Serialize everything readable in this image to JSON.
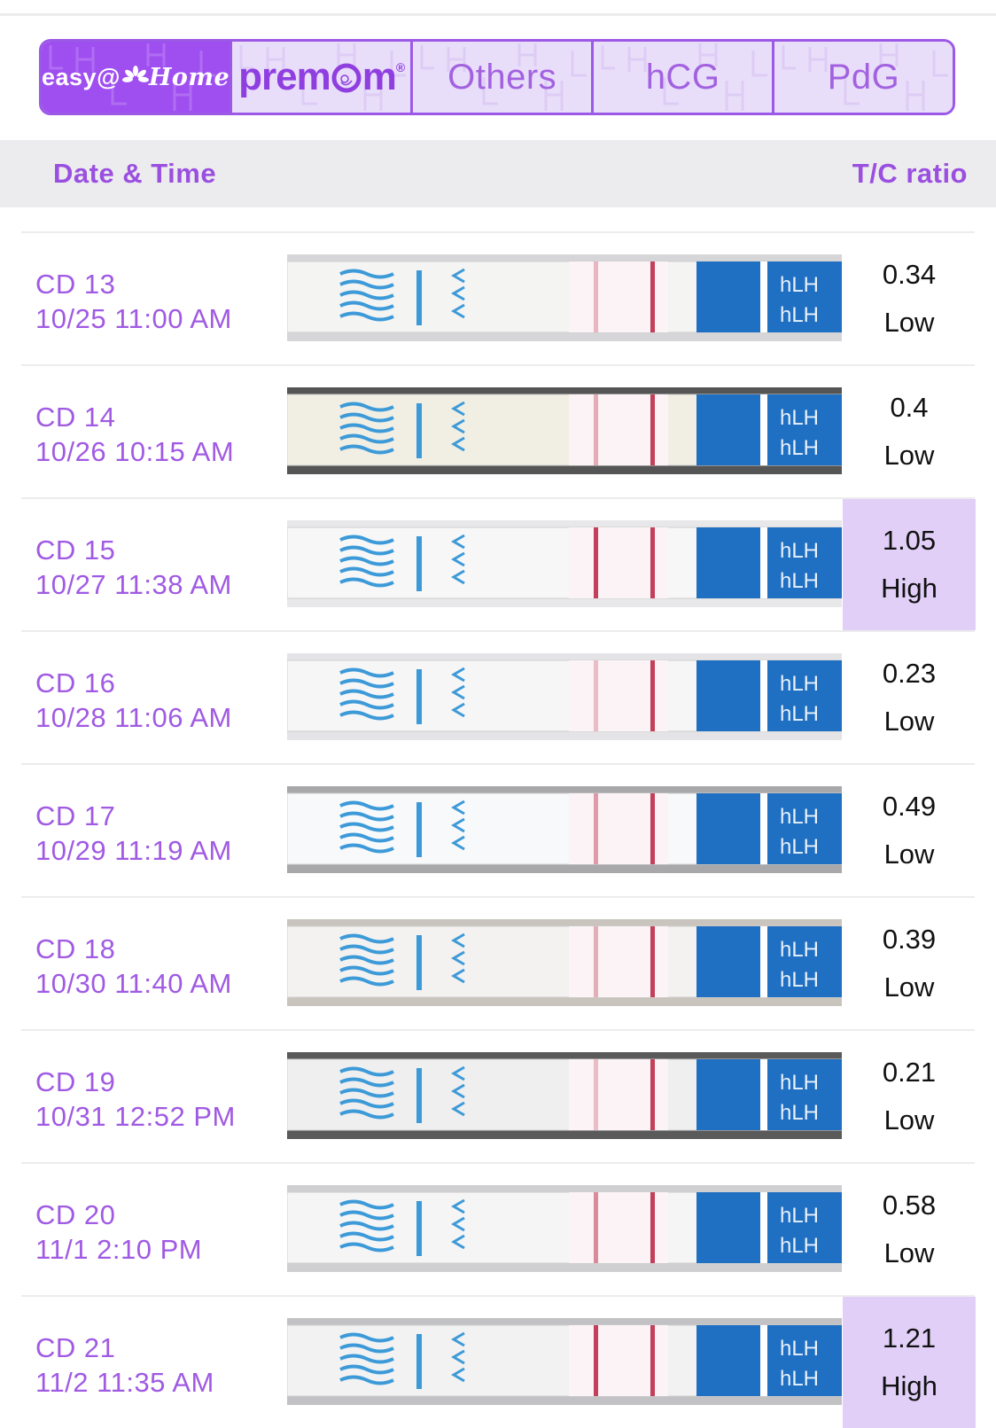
{
  "tabs": {
    "easy_home": {
      "part1": "easy@",
      "part2": "Home"
    },
    "premom": {
      "prefix": "prem",
      "suffix": "m",
      "mark": "®"
    },
    "others": "Others",
    "hcg": "hCG",
    "pdg": "PdG"
  },
  "header": {
    "date_time": "Date & Time",
    "tc_ratio": "T/C ratio"
  },
  "strip_label": "hLH",
  "colors": {
    "accent": "#9f4ef0",
    "high_highlight": "#e1cff8",
    "strip_blue": "#1f6fc2",
    "test_line": "#c2405a"
  },
  "rows": [
    {
      "cd": "CD 13",
      "datetime": "10/25 11:00 AM",
      "ratio": "0.34",
      "level": "Low",
      "high": false,
      "ratio_value": 0.34
    },
    {
      "cd": "CD 14",
      "datetime": "10/26 10:15 AM",
      "ratio": "0.4",
      "level": "Low",
      "high": false,
      "ratio_value": 0.4
    },
    {
      "cd": "CD 15",
      "datetime": "10/27 11:38 AM",
      "ratio": "1.05",
      "level": "High",
      "high": true,
      "ratio_value": 1.05
    },
    {
      "cd": "CD 16",
      "datetime": "10/28 11:06 AM",
      "ratio": "0.23",
      "level": "Low",
      "high": false,
      "ratio_value": 0.23
    },
    {
      "cd": "CD 17",
      "datetime": "10/29 11:19 AM",
      "ratio": "0.49",
      "level": "Low",
      "high": false,
      "ratio_value": 0.49
    },
    {
      "cd": "CD 18",
      "datetime": "10/30 11:40 AM",
      "ratio": "0.39",
      "level": "Low",
      "high": false,
      "ratio_value": 0.39
    },
    {
      "cd": "CD 19",
      "datetime": "10/31 12:52 PM",
      "ratio": "0.21",
      "level": "Low",
      "high": false,
      "ratio_value": 0.21
    },
    {
      "cd": "CD 20",
      "datetime": "11/1 2:10 PM",
      "ratio": "0.58",
      "level": "Low",
      "high": false,
      "ratio_value": 0.58
    },
    {
      "cd": "CD 21",
      "datetime": "11/2 11:35 AM",
      "ratio": "1.21",
      "level": "High",
      "high": true,
      "ratio_value": 1.21
    }
  ]
}
